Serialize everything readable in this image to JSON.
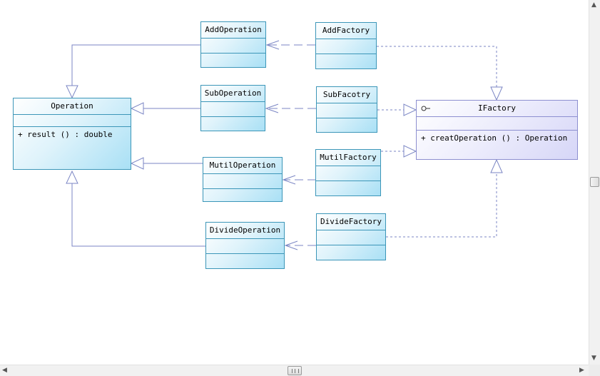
{
  "diagram": {
    "classes": {
      "operation": {
        "name": "Operation",
        "operation": "+ result () : double"
      },
      "add_operation": {
        "name": "AddOperation"
      },
      "sub_operation": {
        "name": "SubOperation"
      },
      "mutil_operation": {
        "name": "MutilOperation"
      },
      "divide_operation": {
        "name": "DivideOperation"
      },
      "add_factory": {
        "name": "AddFactory"
      },
      "sub_factory": {
        "name": "SubFacotry"
      },
      "mutil_factory": {
        "name": "MutilFactory"
      },
      "divide_factory": {
        "name": "DivideFactory"
      },
      "ifactory": {
        "name": "IFactory",
        "operation": "+ creatOperation () : Operation"
      }
    },
    "colors": {
      "class_border": "#3c96b8",
      "class_fill": "#a9e0f5",
      "interface_border": "#8d8fd0",
      "interface_fill": "#d6d6f7",
      "connector": "#7b86c4"
    }
  },
  "scrollbars": {
    "up_arrow": "▲",
    "down_arrow": "▼",
    "left_arrow": "◀",
    "right_arrow": "▶"
  }
}
